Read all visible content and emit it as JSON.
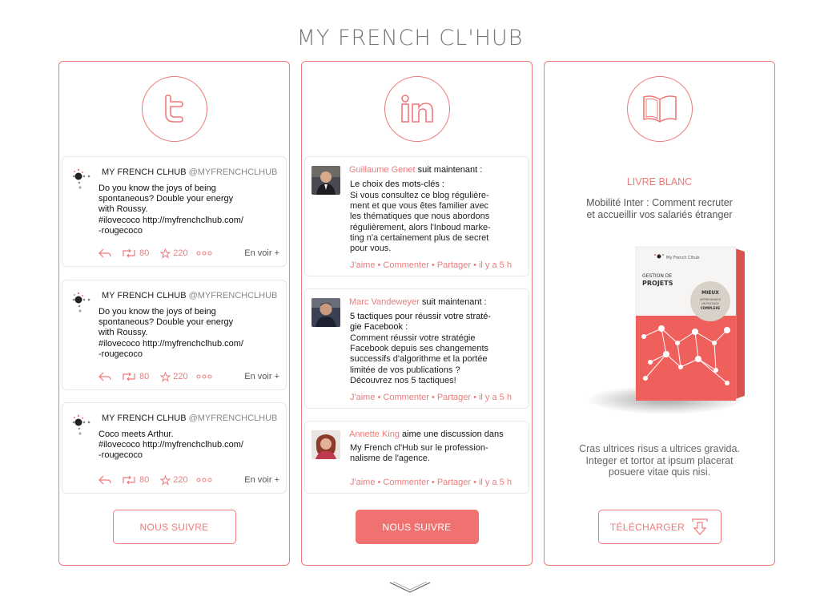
{
  "site": {
    "title": "MY FRENCH CL'HUB"
  },
  "twitter": {
    "icon": "twitter-icon",
    "tweets": [
      {
        "author": "MY FRENCH CLHUB",
        "handle": "@MYFRENCHCLHUB",
        "lines": [
          "Do you know the joys of being",
          "spontaneous? Double your energy",
          "with Roussy.",
          "#ilovecoco http://myfrenchclhub.com/",
          "-rougecoco"
        ],
        "retweets": "80",
        "favorites": "220",
        "more": "En voir +"
      },
      {
        "author": "MY FRENCH CLHUB",
        "handle": "@MYFRENCHCLHUB",
        "lines": [
          "Do you know the joys of being",
          "spontaneous? Double your energy",
          "with Roussy.",
          "#ilovecoco http://myfrenchclhub.com/",
          "-rougecoco"
        ],
        "retweets": "80",
        "favorites": "220",
        "more": "En voir +"
      },
      {
        "author": "MY FRENCH CLHUB",
        "handle": "@MYFRENCHCLHUB",
        "lines": [
          "Coco meets Arthur.",
          "#ilovecoco http://myfrenchclhub.com/",
          "-rougecoco"
        ],
        "retweets": "80",
        "favorites": "220",
        "more": "En voir +"
      }
    ],
    "button": "NOUS SUIVRE"
  },
  "linkedin": {
    "icon": "linkedin-icon",
    "posts": [
      {
        "name": "Guillaume Genet",
        "verb": " suit maintenant :",
        "subject_lines": [
          "Le choix des mots-clés :"
        ],
        "body_lines": [
          "Si vous consultez ce blog régulière-",
          "ment et que vous êtes familier avec",
          "les thématiques que nous abordons",
          "régulièrement, alors l'Inboud marke-",
          "ting n'a certainement plus de secret",
          "pour vous."
        ],
        "actions": "J'aime • Commenter • Partager • il y a 5 h"
      },
      {
        "name": "Marc  Vandeweyer",
        "verb": " suit maintenant :",
        "subject_lines": [
          "5 tactiques pour réussir votre straté-",
          "gie Facebook  :"
        ],
        "body_lines": [
          "Comment réussir votre stratégie",
          "Facebook depuis ses changements",
          "successifs d'algorithme et la portée",
          "limitée de vos publications ?",
          "Découvrez nos 5 tactiques!"
        ],
        "actions": "J'aime • Commenter • Partager • il y a 5 h"
      },
      {
        "name": "Annette King",
        "verb": " aime une discussion dans",
        "subject_lines": [],
        "body_lines": [
          "My French cl'Hub sur le profession-",
          "nalisme de l'agence."
        ],
        "actions": "J'aime • Commenter • Partager • il y a 5 h"
      }
    ],
    "button": "NOUS SUIVRE"
  },
  "book": {
    "icon": "open-book-icon",
    "kicker": "LIVRE BLANC",
    "desc_lines": [
      "Mobilité Inter : Comment recruter",
      "et accueillir vos salariés étranger"
    ],
    "cover": {
      "brand": "My French Clhub",
      "title_top": "GESTION DE",
      "title_main": "PROJETS",
      "badge_lines": [
        "MIEUX",
        "APPREHENDER",
        "UN PAYSAGE",
        "COMPLEXE"
      ]
    },
    "foot_lines": [
      "Cras ultrices risus a ultrices gravida.",
      "Integer et tortor at ipsum placerat",
      "posuere vitae quis nisi."
    ],
    "button": "TÉLÉCHARGER",
    "button_icon": "download-icon"
  },
  "footer": {
    "icon": "chevron-down-icon"
  },
  "colors": {
    "accent": "#ef7a7a",
    "accent_fill": "#ef7270"
  }
}
